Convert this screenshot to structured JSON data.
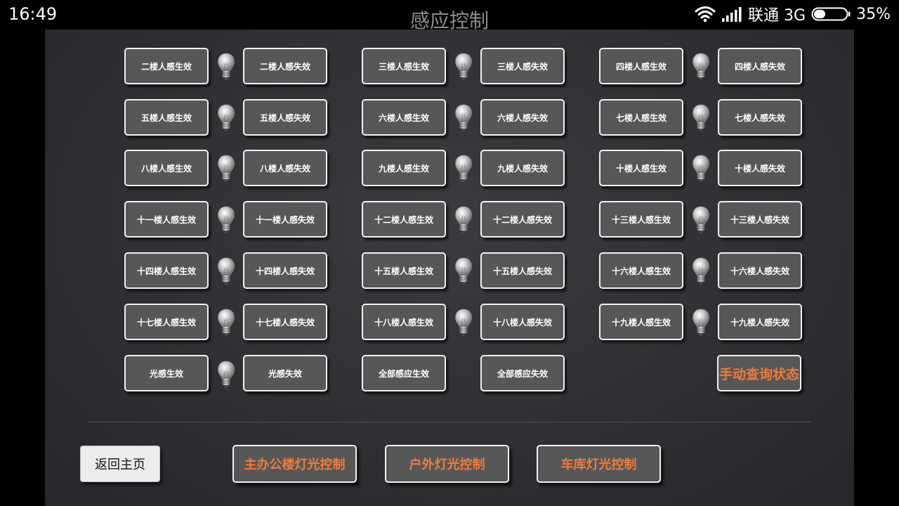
{
  "status_bar": {
    "time": "16:49",
    "carrier": "联通 3G",
    "battery": "35%",
    "battery_level": 0.35
  },
  "title": "感应控制",
  "grid": {
    "rows": [
      [
        "二楼人感生效",
        "二楼人感失效",
        "三楼人感生效",
        "三楼人感失效",
        "四楼人感生效",
        "四楼人感失效"
      ],
      [
        "五楼人感生效",
        "五楼人感失效",
        "六楼人感生效",
        "六楼人感失效",
        "七楼人感生效",
        "七楼人感失效"
      ],
      [
        "八楼人感生效",
        "八楼人感失效",
        "九楼人感生效",
        "九楼人感失效",
        "十楼人感生效",
        "十楼人感失效"
      ],
      [
        "十一楼人感生效",
        "十一楼人感失效",
        "十二楼人感生效",
        "十二楼人感失效",
        "十三楼人感生效",
        "十三楼人感失效"
      ],
      [
        "十四楼人感生效",
        "十四楼人感失效",
        "十五楼人感生效",
        "十五楼人感失效",
        "十六楼人感生效",
        "十六楼人感失效"
      ],
      [
        "十七楼人感生效",
        "十七楼人感失效",
        "十八楼人感生效",
        "十八楼人感失效",
        "十九楼人感生效",
        "十九楼人感失效"
      ]
    ],
    "last_row": {
      "light_on": "光感生效",
      "light_off": "光感失效",
      "all_on": "全部感应生效",
      "all_off": "全部感应失效",
      "query": "手动查询状态"
    }
  },
  "bottom": {
    "home": "返回主页",
    "main_building": "主办公楼灯光控制",
    "outdoor": "户外灯光控制",
    "garage": "车库灯光控制"
  },
  "colors": {
    "accent": "#f07a3a",
    "button_bg": "#575757",
    "panel_bg": "#2e2f32"
  },
  "icons": {
    "bulb": "light-bulb-icon",
    "wifi": "wifi-icon",
    "signal": "signal-icon",
    "battery": "battery-icon"
  }
}
